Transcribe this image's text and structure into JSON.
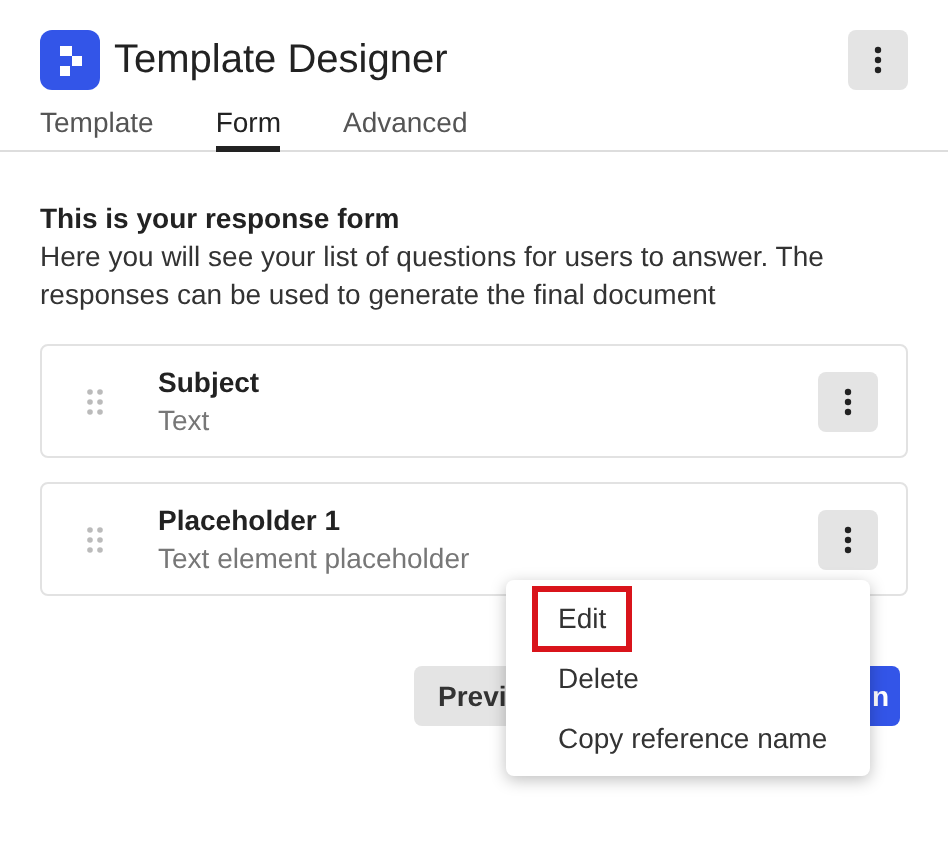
{
  "header": {
    "title": "Template Designer"
  },
  "tabs": [
    {
      "label": "Template",
      "selected": false
    },
    {
      "label": "Form",
      "selected": true
    },
    {
      "label": "Advanced",
      "selected": false
    }
  ],
  "intro": {
    "heading": "This is your response form",
    "description": "Here you will see your list of questions for users to answer. The responses can be used to generate the final document"
  },
  "questions": [
    {
      "title": "Subject",
      "subtitle": "Text"
    },
    {
      "title": "Placeholder 1",
      "subtitle": "Text element placeholder"
    }
  ],
  "buttons": [
    {
      "label": "Previ",
      "kind": "secondary"
    },
    {
      "label": "n",
      "kind": "primary"
    }
  ],
  "menu": [
    {
      "label": "Edit",
      "highlighted": true
    },
    {
      "label": "Delete",
      "highlighted": false
    },
    {
      "label": "Copy reference name",
      "highlighted": false
    }
  ]
}
